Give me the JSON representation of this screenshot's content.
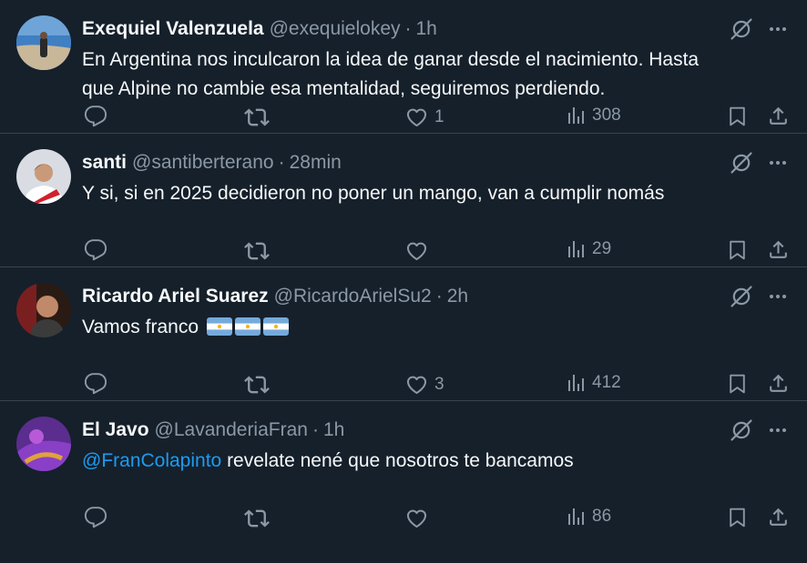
{
  "tweets": [
    {
      "name": "Exequiel Valenzuela",
      "handle": "@exequielokey",
      "separator": "·",
      "time": "1h",
      "text_line1": "En Argentina nos inculcaron la idea de ganar desde el nacimiento. Hasta",
      "text_line2": "que Alpine no cambie esa mentalidad, seguiremos perdiendo.",
      "likes": "1",
      "views": "308"
    },
    {
      "name": "santi",
      "handle": "@santiberterano",
      "separator": "·",
      "time": "28min",
      "text": "Y si, si en 2025 decidieron no poner un mango, van a cumplir nomás",
      "likes": "",
      "views": "29"
    },
    {
      "name": "Ricardo Ariel Suarez",
      "handle": "@RicardoArielSu2",
      "separator": "·",
      "time": "2h",
      "text": "Vamos franco",
      "likes": "3",
      "views": "412"
    },
    {
      "name": "El Javo",
      "handle": "@LavanderiaFran",
      "separator": "·",
      "time": "1h",
      "mention": "@FranColapinto",
      "text": " revelate nené que nosotros te bancamos",
      "likes": "",
      "views": "86"
    }
  ],
  "colors": {
    "background": "#15202b",
    "text": "#f7f9f9",
    "secondary": "#8b98a5",
    "link": "#1d9bf0",
    "divider": "#38444d"
  },
  "icons": [
    "reply-icon",
    "retweet-icon",
    "like-icon",
    "views-icon",
    "bookmark-icon",
    "share-icon",
    "grok-icon",
    "more-icon",
    "argentina-flag-icon"
  ]
}
